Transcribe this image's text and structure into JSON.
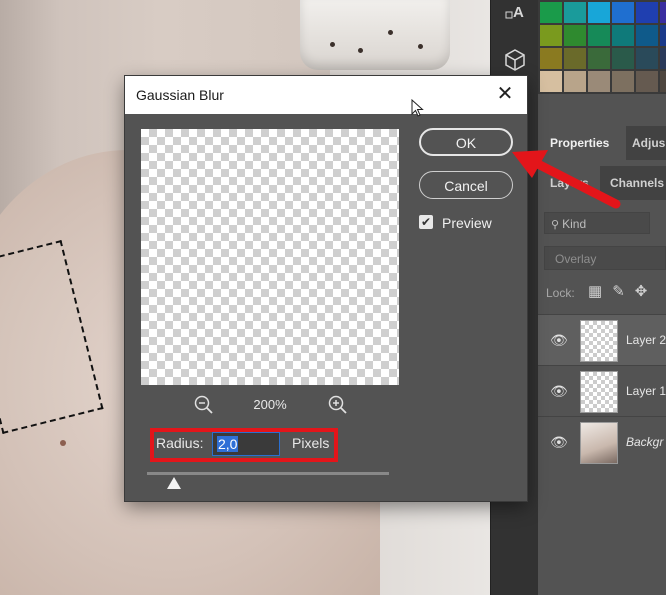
{
  "dialog": {
    "title": "Gaussian Blur",
    "ok_label": "OK",
    "cancel_label": "Cancel",
    "preview_label": "Preview",
    "preview_checked": true,
    "zoom_level": "200%",
    "radius_label": "Radius:",
    "radius_value": "2,0",
    "radius_unit": "Pixels"
  },
  "panel": {
    "tabs": [
      "Properties",
      "Adjus"
    ],
    "layer_tabs": [
      "Layers",
      "Channels"
    ],
    "kind_filter": "Kind",
    "blend_mode": "Overlay",
    "lock_label": "Lock:",
    "layers": [
      {
        "name": "Layer 2",
        "selected": true
      },
      {
        "name": "Layer 1",
        "selected": false
      },
      {
        "name": "Backgr",
        "selected": false
      }
    ]
  },
  "swatch_colors": [
    "#1a9b4a",
    "#1a9b9b",
    "#18a6d8",
    "#1f6fd0",
    "#1f3fb0",
    "#3a2da0",
    "#7a9a1e",
    "#2f8a2f",
    "#168a58",
    "#0f7a7a",
    "#0f5a8a",
    "#1a3a8a",
    "#8a7a20",
    "#6a6a2a",
    "#3a6a3a",
    "#2a5a4a",
    "#2a4a5a",
    "#2a3a5a",
    "#d6bfa0",
    "#b8a48a",
    "#9a8a78",
    "#7d7060",
    "#655a50",
    "#4e463f"
  ],
  "annotation_color": "#e3151a"
}
